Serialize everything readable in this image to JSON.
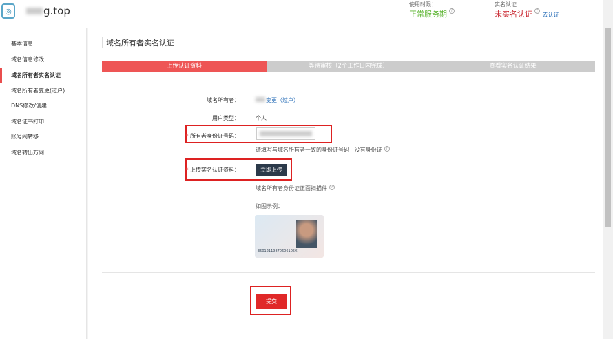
{
  "header": {
    "domain_suffix": "g.top",
    "service_label": "使用时限：",
    "service_value": "正常服务期",
    "realname_label": "实名认证",
    "realname_value": "未实名认证",
    "verify_link": "去认证",
    "colors": {
      "green": "#5cb531",
      "red": "#c8202a",
      "link": "#2a6fb8"
    }
  },
  "sidebar": {
    "items": [
      {
        "label": "基本信息"
      },
      {
        "label": "域名信息修改"
      },
      {
        "label": "域名所有者实名认证"
      },
      {
        "label": "域名所有者变更(过户)"
      },
      {
        "label": "DNS修改/创建"
      },
      {
        "label": "域名证书打印"
      },
      {
        "label": "账号间转移"
      },
      {
        "label": "域名转出万网"
      }
    ]
  },
  "main": {
    "title": "域名所有者实名认证",
    "steps": [
      {
        "label": "上传认证资料"
      },
      {
        "label": "等待审核（2个工作日内完成）"
      },
      {
        "label": "查看实名认证结果"
      }
    ],
    "owner_label": "域名所有者：",
    "owner_change": "变更（过户）",
    "user_type_label": "用户类型：",
    "user_type_value": "个人",
    "id_label": "所有者身份证号码：",
    "id_hint": "请填写与域名所有者一致的身份证号码",
    "no_id": "没有身份证",
    "upload_label": "上传实名认证资料：",
    "upload_button": "立即上传",
    "upload_hint": "域名所有者身份证正面扫描件",
    "example_label": "如图示例：",
    "example_id_number": "35012119870606105X",
    "required_mark": "*",
    "submit": "提交"
  }
}
